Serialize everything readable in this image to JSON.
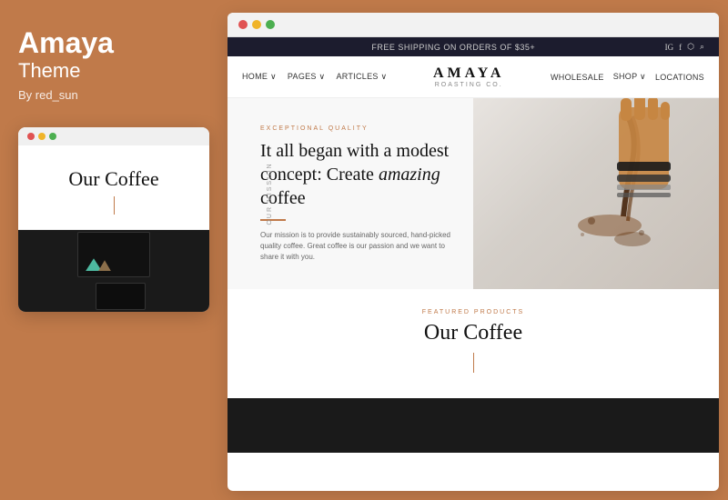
{
  "left": {
    "title": "Amaya",
    "subtitle": "Theme",
    "author": "By red_sun",
    "mini_preview": {
      "our_coffee_label": "Our Coffee",
      "dots": [
        "#e05252",
        "#f0b429",
        "#4caf50"
      ]
    }
  },
  "browser_bar": {
    "dots": [
      "#e05252",
      "#f0b429",
      "#4caf50"
    ]
  },
  "topbar": {
    "message": "FREE SHIPPING ON ORDERS OF $35+",
    "icons": [
      "IG",
      "f",
      "📷",
      "🔍"
    ]
  },
  "nav": {
    "left_links": [
      "HOME ∨",
      "PAGES ∨",
      "ARTICLES ∨"
    ],
    "logo_main": "AMAYA",
    "logo_sub": "ROASTING CO.",
    "right_links": [
      "WHOLESALE",
      "SHOP ∨",
      "LOCATIONS"
    ]
  },
  "hero": {
    "side_label": "OUR MISSION",
    "tag": "EXCEPTIONAL QUALITY",
    "title_part1": "It all began with a modest concept: Create ",
    "title_italic": "amazing",
    "title_part2": " coffee",
    "description": "Our mission is to provide sustainably sourced, hand-picked quality coffee. Great coffee is our passion and we want to share it with you."
  },
  "featured": {
    "tag": "FEATURED PRODUCTS",
    "title": "Our Coffee"
  },
  "colors": {
    "accent": "#c07a4a",
    "dark": "#1c1c2e",
    "dot_red": "#e05252",
    "dot_yellow": "#f0b429",
    "dot_green": "#4caf50"
  }
}
